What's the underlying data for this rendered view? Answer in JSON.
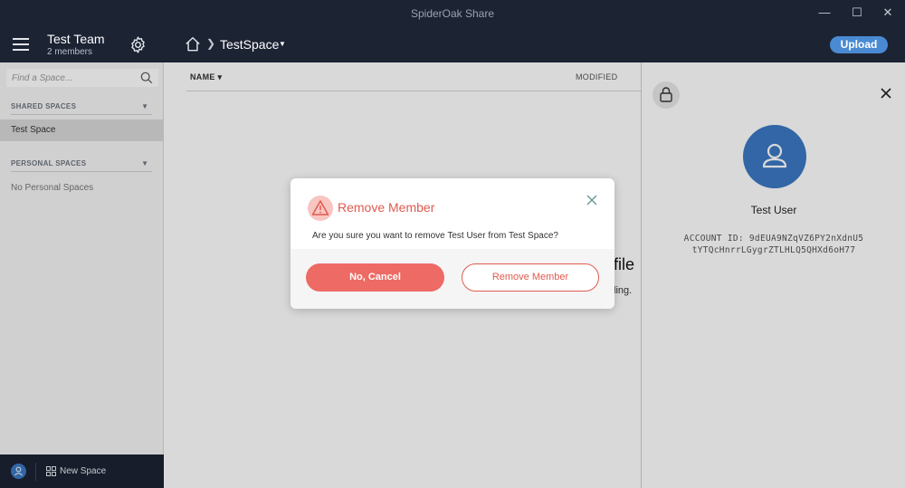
{
  "window": {
    "title": "SpiderOak Share",
    "controls": [
      "minimize-icon",
      "maximize-icon",
      "close-icon"
    ]
  },
  "header": {
    "team_name": "Test Team",
    "team_members": "2 members",
    "breadcrumb_space": "TestSpace",
    "upload_label": "Upload"
  },
  "sidebar": {
    "search_placeholder": "Find a Space...",
    "shared_spaces_label": "SHARED SPACES",
    "shared_spaces": [
      "Test Space"
    ],
    "personal_spaces_label": "PERSONAL SPACES",
    "personal_spaces_empty": "No Personal Spaces",
    "new_space_label": "New Space"
  },
  "main": {
    "column_name": "NAME ▾",
    "column_modified": "MODIFIED",
    "empty_title_fragment": "file",
    "empty_sub_fragment": "ling."
  },
  "panel": {
    "user_name": "Test User",
    "account_id_line1": "ACCOUNT ID: 9dEUA9NZqVZ6PY2nXdnU5",
    "account_id_line2": "tYTQcHnrrLGygrZTLHLQ5QHXd6oH77"
  },
  "modal": {
    "title": "Remove Member",
    "message": "Are you sure you want to remove Test User from Test Space?",
    "cancel_label": "No, Cancel",
    "confirm_label": "Remove Member"
  },
  "colors": {
    "dark_bar": "#1c2333",
    "accent_blue": "#3b78c4",
    "danger": "#e05a4f",
    "danger_fill": "#ee6a64"
  }
}
